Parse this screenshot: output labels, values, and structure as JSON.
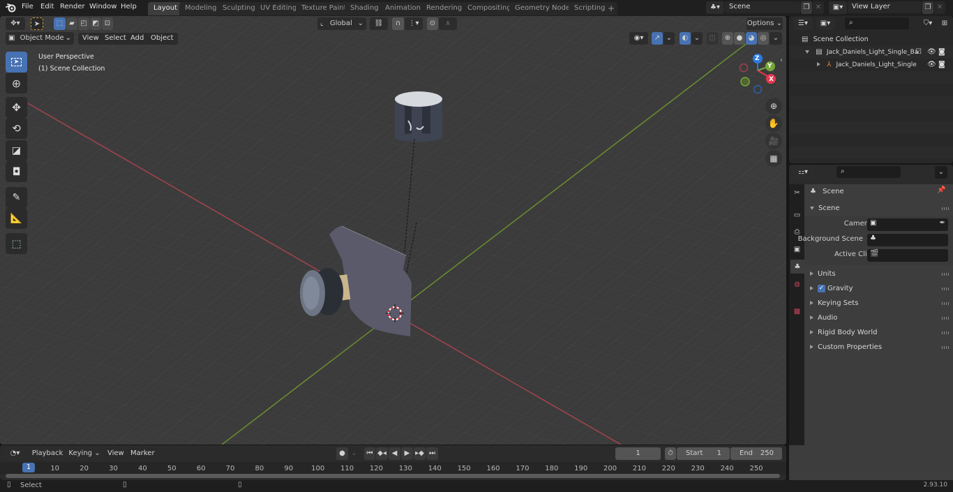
{
  "menu": {
    "items": [
      "File",
      "Edit",
      "Render",
      "Window",
      "Help"
    ]
  },
  "workspaces": {
    "tabs": [
      "Layout",
      "Modeling",
      "Sculpting",
      "UV Editing",
      "Texture Paint",
      "Shading",
      "Animation",
      "Rendering",
      "Compositing",
      "Geometry Nodes",
      "Scripting"
    ],
    "active": "Layout",
    "add_label": "+"
  },
  "scene_selector": {
    "value": "Scene"
  },
  "view_layer_selector": {
    "value": "View Layer"
  },
  "viewport": {
    "mode": "Object Mode",
    "menus": [
      "View",
      "Select",
      "Add",
      "Object"
    ],
    "transform_orientation": "Global",
    "options_label": "Options",
    "overlay_title": "User Perspective",
    "overlay_subtitle": "(1) Scene Collection",
    "gizmo": {
      "x": "X",
      "y": "Y",
      "z": "Z"
    },
    "colors": {
      "x_axis": "#e6374e",
      "y_axis": "#76a63a",
      "z_axis": "#2a7ae2",
      "active_tool": "#4772b3"
    },
    "tools": [
      "select-box",
      "cursor",
      "move",
      "rotate",
      "scale",
      "transform",
      "annotate",
      "measure",
      "add-cube"
    ]
  },
  "outliner": {
    "root": "Scene Collection",
    "items": [
      {
        "name": "Jack_Daniels_Light_Single_Ba",
        "type": "collection",
        "checked": true
      },
      {
        "name": "Jack_Daniels_Light_Single",
        "type": "armature"
      }
    ]
  },
  "properties": {
    "header": "Scene",
    "panel_title": "Scene",
    "fields": [
      {
        "label": "Camera"
      },
      {
        "label": "Background Scene"
      },
      {
        "label": "Active Clip"
      }
    ],
    "collapsed_panels": [
      "Units",
      "Gravity",
      "Keying Sets",
      "Audio",
      "Rigid Body World",
      "Custom Properties"
    ],
    "gravity_enabled": true
  },
  "timeline": {
    "menus": [
      "Playback",
      "Keying",
      "View",
      "Marker"
    ],
    "current_frame": "1",
    "start_label": "Start",
    "start_value": "1",
    "end_label": "End",
    "end_value": "250",
    "ticks": [
      "10",
      "20",
      "30",
      "40",
      "50",
      "60",
      "70",
      "80",
      "90",
      "100",
      "110",
      "120",
      "130",
      "140",
      "150",
      "160",
      "170",
      "180",
      "190",
      "200",
      "210",
      "220",
      "230",
      "240",
      "250"
    ],
    "playhead_label": "1"
  },
  "statusbar": {
    "left_label": "Select",
    "version": "2.93.10"
  }
}
